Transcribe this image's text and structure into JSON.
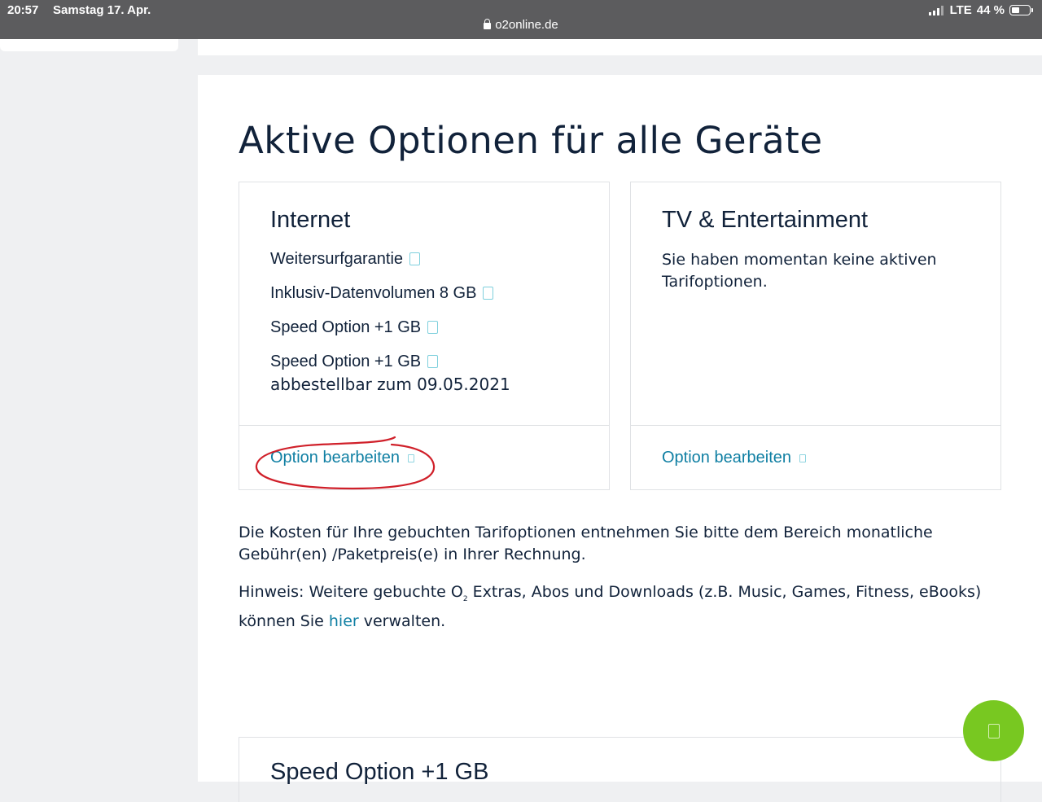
{
  "statusbar": {
    "time": "20:57",
    "date": "Samstag 17. Apr.",
    "network": "LTE",
    "battery": "44 %",
    "url": "o2online.de"
  },
  "page": {
    "title": "Aktive Optionen für alle Geräte"
  },
  "cards": {
    "internet": {
      "title": "Internet",
      "options": [
        {
          "label": "Weitersurfgarantie"
        },
        {
          "label": "Inklusiv-Datenvolumen 8 GB"
        },
        {
          "label": "Speed Option +1 GB"
        },
        {
          "label": "Speed Option +1 GB",
          "note": "abbestellbar zum 09.05.2021"
        }
      ],
      "edit_label": "Option bearbeiten"
    },
    "tv": {
      "title": "TV & Entertainment",
      "empty_text": "Sie haben momentan keine aktiven Tarifoptionen.",
      "edit_label": "Option bearbeiten"
    }
  },
  "info": {
    "para1": "Die Kosten für Ihre gebuchten Tarifoptionen entnehmen Sie bitte dem Bereich monatliche Gebühr(en) /Paketpreis(e) in Ihrer Rechnung.",
    "para2_a": "Hinweis: Weitere gebuchte O",
    "para2_sub": "2",
    "para2_b": " Extras, Abos und Downloads (z.B. Music, Games, Fitness, eBooks) können Sie ",
    "para2_link": "hier",
    "para2_c": " verwalten."
  },
  "next_card": {
    "title": "Speed Option +1 GB"
  },
  "colors": {
    "accent_link": "#0f7fa3",
    "fab": "#78c821",
    "annotation": "#d0202a"
  },
  "icons": {
    "fab": "chat-icon",
    "info": "info-icon"
  }
}
